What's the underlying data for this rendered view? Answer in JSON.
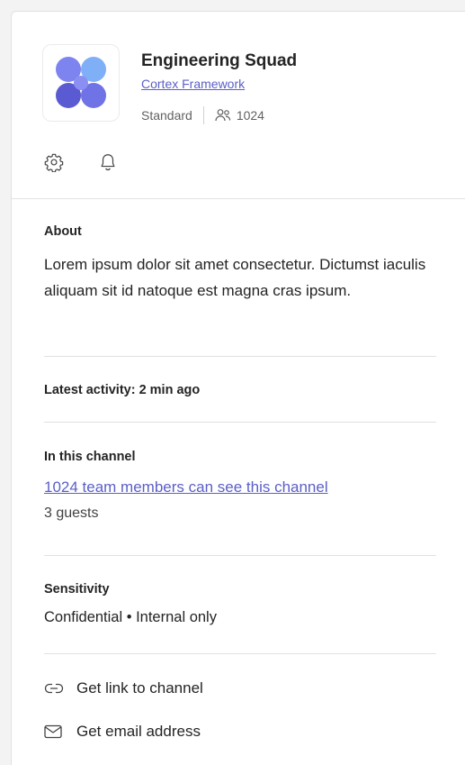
{
  "team": {
    "name": "Engineering Squad",
    "parent_link": "Cortex Framework",
    "type": "Standard",
    "member_count": "1024"
  },
  "header_icons": [
    "gear-icon",
    "bell-icon"
  ],
  "about": {
    "title": "About",
    "body": "Lorem ipsum dolor sit amet consectetur. Dictumst iaculis aliquam sit id natoque est magna cras ipsum."
  },
  "activity": {
    "label": "Latest activity: 2 min ago"
  },
  "channel": {
    "title": "In this channel",
    "members_link": "1024 team members can see this channel",
    "guests": "3 guests"
  },
  "sensitivity": {
    "title": "Sensitivity",
    "value": "Confidential • Internal only"
  },
  "actions": {
    "link_label": "Get link to channel",
    "email_label": "Get email address"
  },
  "colors": {
    "accent": "#5b5fc7",
    "logo_light": "#7f86f0",
    "logo_dark": "#5c5fd6",
    "divider": "#e1e1e1"
  }
}
